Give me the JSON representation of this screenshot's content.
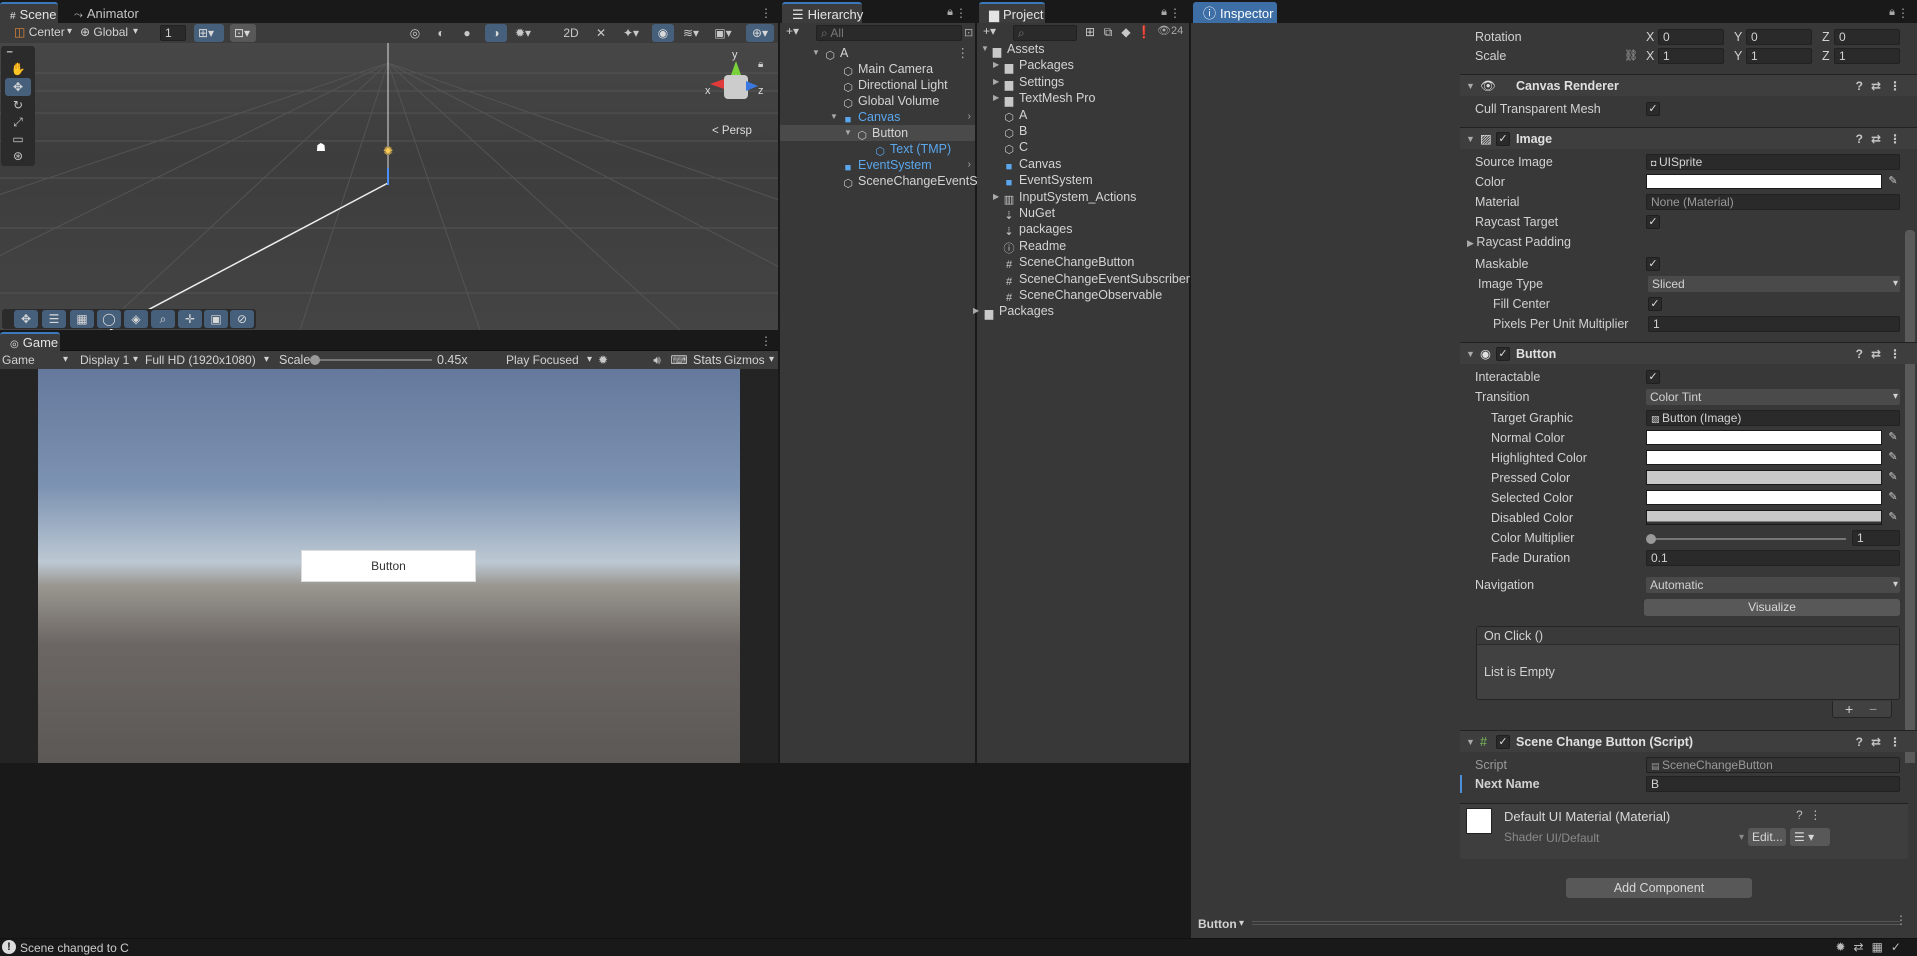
{
  "scene_tab": {
    "scene": "Scene",
    "animator": "Animator"
  },
  "scene_toolbar": {
    "pivot": "Center",
    "space": "Global",
    "snap_value": "1",
    "persp": "< Persp",
    "gizmo_y": "y",
    "gizmo_x": "x",
    "gizmo_z": "z"
  },
  "game": {
    "tab": "Game",
    "mode": "Game",
    "display": "Display 1",
    "resolution": "Full HD (1920x1080)",
    "scale_label": "Scale",
    "scale_value": "0.45x",
    "scale_fraction": 0.0,
    "play_mode": "Play Focused",
    "stats": "Stats",
    "gizmos": "Gizmos",
    "button_text": "Button"
  },
  "hierarchy": {
    "tab": "Hierarchy",
    "search_placeholder": "All",
    "items": [
      {
        "label": "A"
      },
      {
        "label": "Main Camera"
      },
      {
        "label": "Directional Light"
      },
      {
        "label": "Global Volume"
      },
      {
        "label": "Canvas"
      },
      {
        "label": "Button"
      },
      {
        "label": "Text (TMP)"
      },
      {
        "label": "EventSystem"
      },
      {
        "label": "SceneChangeEventSubscrib"
      }
    ]
  },
  "project": {
    "tab": "Project",
    "count": "24",
    "items": [
      {
        "label": "Assets"
      },
      {
        "label": "Packages"
      },
      {
        "label": "Settings"
      },
      {
        "label": "TextMesh Pro"
      },
      {
        "label": "A"
      },
      {
        "label": "B"
      },
      {
        "label": "C"
      },
      {
        "label": "Canvas"
      },
      {
        "label": "EventSystem"
      },
      {
        "label": "InputSystem_Actions"
      },
      {
        "label": "NuGet"
      },
      {
        "label": "packages"
      },
      {
        "label": "Readme"
      },
      {
        "label": "SceneChangeButton"
      },
      {
        "label": "SceneChangeEventSubscriber"
      },
      {
        "label": "SceneChangeObservable"
      },
      {
        "label": "Packages"
      }
    ]
  },
  "inspector": {
    "tab": "Inspector",
    "rotation": {
      "label": "Rotation",
      "x": "0",
      "y": "0",
      "z": "0"
    },
    "scale": {
      "label": "Scale",
      "x": "1",
      "y": "1",
      "z": "1"
    },
    "axis": {
      "x": "X",
      "y": "Y",
      "z": "Z"
    },
    "canvas_renderer": {
      "title": "Canvas Renderer",
      "cull_label": "Cull Transparent Mesh"
    },
    "image": {
      "title": "Image",
      "source_label": "Source Image",
      "source_value": "UISprite",
      "color_label": "Color",
      "material_label": "Material",
      "material_value": "None (Material)",
      "raycast_target": "Raycast Target",
      "raycast_padding": "Raycast Padding",
      "maskable": "Maskable",
      "image_type_label": "Image Type",
      "image_type_value": "Sliced",
      "fill_center": "Fill Center",
      "ppu_label": "Pixels Per Unit Multiplier",
      "ppu_value": "1"
    },
    "button": {
      "title": "Button",
      "interactable": "Interactable",
      "transition_label": "Transition",
      "transition_value": "Color Tint",
      "target_graphic_label": "Target Graphic",
      "target_graphic_value": "Button (Image)",
      "normal": "Normal Color",
      "highlighted": "Highlighted Color",
      "pressed": "Pressed Color",
      "selected": "Selected Color",
      "disabled": "Disabled Color",
      "multiplier_label": "Color Multiplier",
      "multiplier_value": "1",
      "fade_label": "Fade Duration",
      "fade_value": "0.1",
      "navigation_label": "Navigation",
      "navigation_value": "Automatic",
      "visualize": "Visualize",
      "onclick": "On Click ()",
      "list_empty": "List is Empty",
      "plus": "+",
      "minus": "−"
    },
    "script_comp": {
      "title": "Scene Change Button (Script)",
      "script_label": "Script",
      "script_value": "SceneChangeButton",
      "next_label": "Next Name",
      "next_value": "B"
    },
    "material": {
      "title": "Default UI Material (Material)",
      "shader_label": "Shader",
      "shader_value": "UI/Default",
      "edit": "Edit..."
    },
    "add_component": "Add Component",
    "footer": "Button"
  },
  "status": {
    "message": "Scene changed to C"
  },
  "colors": {
    "accent": "#3d6fa6",
    "selected_blue": "#5aa7ee",
    "pressed": "#c8c8c8",
    "disabled": "#c8c8c8"
  }
}
